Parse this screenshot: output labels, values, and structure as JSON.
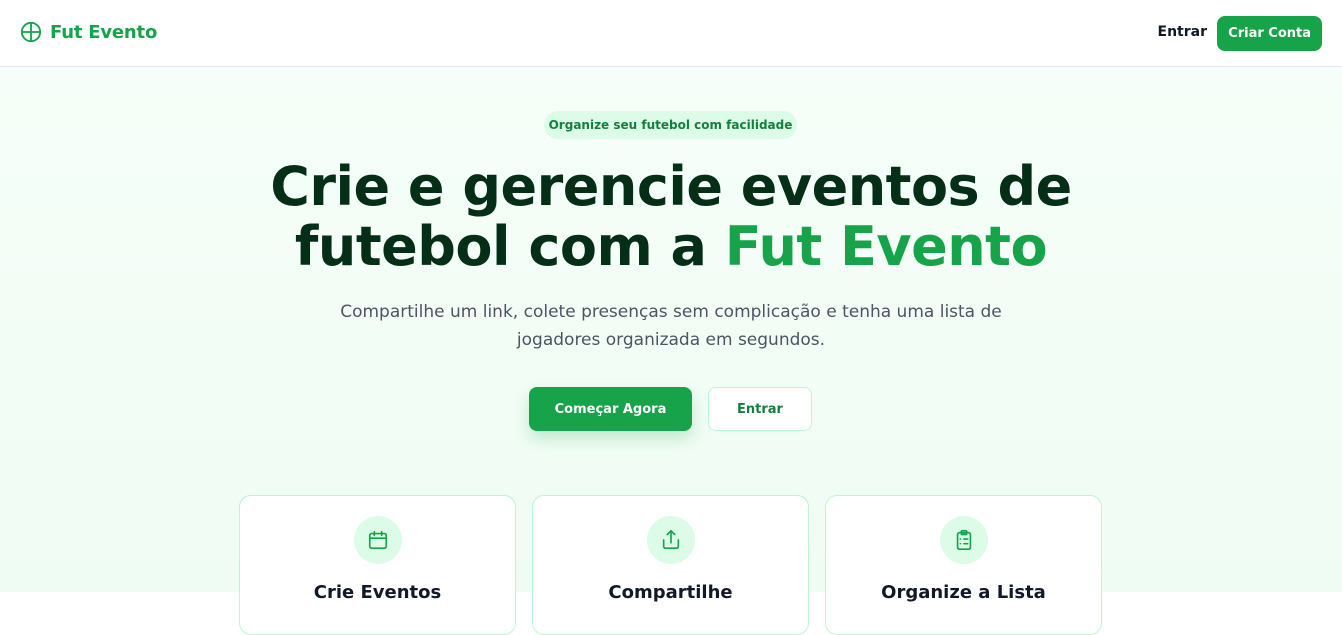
{
  "nav": {
    "brand_name": "Fut Evento",
    "login_label": "Entrar",
    "signup_label": "Criar Conta"
  },
  "hero": {
    "badge": "Organize seu futebol com facilidade",
    "headline_line1": "Crie e gerencie eventos de",
    "headline_line2_prefix": "futebol com a ",
    "headline_accent": "Fut Evento",
    "subtitle": "Compartilhe um link, colete presenças sem complicação e tenha uma lista de jogadores organizada em segundos.",
    "primary_cta": "Começar Agora",
    "secondary_cta": "Entrar"
  },
  "features": [
    {
      "icon": "calendar-icon",
      "title": "Crie Eventos"
    },
    {
      "icon": "share-icon",
      "title": "Compartilhe"
    },
    {
      "icon": "clipboard-list-icon",
      "title": "Organize a Lista"
    }
  ],
  "colors": {
    "brand": "#16a34a",
    "headline": "#052e16",
    "badge_bg": "#dcfce7"
  }
}
